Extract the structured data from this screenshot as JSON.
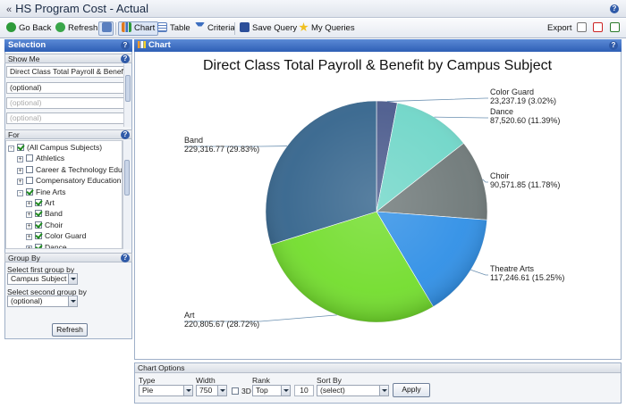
{
  "window": {
    "title": "HS Program Cost - Actual"
  },
  "toolbar": {
    "go_back": "Go Back",
    "refresh": "Refresh",
    "chart": "Chart",
    "table": "Table",
    "criteria": "Criteria",
    "save_query": "Save Query",
    "my_queries": "My Queries",
    "export": "Export"
  },
  "selection": {
    "header": "Selection",
    "show_me": {
      "label": "Show Me",
      "measure": "Direct Class Total Payroll & Benefit",
      "optional1": "(optional)",
      "placeholder2": "(optional)",
      "placeholder3": "(optional)"
    },
    "for": {
      "label": "For",
      "items": [
        {
          "label": "(All Campus Subjects)",
          "checked": true,
          "expander": "-",
          "level": 0
        },
        {
          "label": "Athletics",
          "checked": false,
          "expander": "+",
          "level": 1
        },
        {
          "label": "Career & Technology Educ",
          "checked": false,
          "expander": "+",
          "level": 1
        },
        {
          "label": "Compensatory Education",
          "checked": false,
          "expander": "+",
          "level": 1
        },
        {
          "label": "Fine Arts",
          "checked": true,
          "expander": "-",
          "level": 1
        },
        {
          "label": "Art",
          "checked": true,
          "expander": "+",
          "level": 2
        },
        {
          "label": "Band",
          "checked": true,
          "expander": "+",
          "level": 2
        },
        {
          "label": "Choir",
          "checked": true,
          "expander": "+",
          "level": 2
        },
        {
          "label": "Color Guard",
          "checked": true,
          "expander": "+",
          "level": 2
        },
        {
          "label": "Dance",
          "checked": true,
          "expander": "+",
          "level": 2
        }
      ]
    },
    "group_by": {
      "label": "Group By",
      "first_label": "Select first group by",
      "first_value": "Campus Subject",
      "second_label": "Select second group by",
      "second_value": "(optional)"
    },
    "refresh_button": "Refresh"
  },
  "chart_panel": {
    "header": "Chart"
  },
  "chart_data": {
    "type": "pie",
    "title": "Direct Class Total Payroll & Benefit by Campus Subject",
    "series": [
      {
        "name": "Color Guard",
        "value": 23237.19,
        "value_label": "23,237.19 (3.02%)",
        "percent": 3.02,
        "color": "#4a5a8c"
      },
      {
        "name": "Dance",
        "value": 87520.6,
        "value_label": "87,520.60 (11.39%)",
        "percent": 11.39,
        "color": "#6fd6c8"
      },
      {
        "name": "Choir",
        "value": 90571.85,
        "value_label": "90,571.85 (11.78%)",
        "percent": 11.78,
        "color": "#6e7878"
      },
      {
        "name": "Theatre Arts",
        "value": 117246.61,
        "value_label": "117,246.61 (15.25%)",
        "percent": 15.25,
        "color": "#2f8fe6"
      },
      {
        "name": "Art",
        "value": 220805.67,
        "value_label": "220,805.67 (28.72%)",
        "percent": 28.72,
        "color": "#72dd2c"
      },
      {
        "name": "Band",
        "value": 229316.77,
        "value_label": "229,316.77 (29.83%)",
        "percent": 29.83,
        "color": "#34648c"
      }
    ],
    "legend": "none"
  },
  "chart_options": {
    "header": "Chart Options",
    "type_label": "Type",
    "type_value": "Pie",
    "width_label": "Width",
    "width_value": "750",
    "three_d_label": "3D",
    "three_d_checked": false,
    "rank_label": "Rank",
    "rank_value": "Top",
    "rank_count": "10",
    "sort_label": "Sort By",
    "sort_value": "(select)",
    "apply": "Apply"
  }
}
